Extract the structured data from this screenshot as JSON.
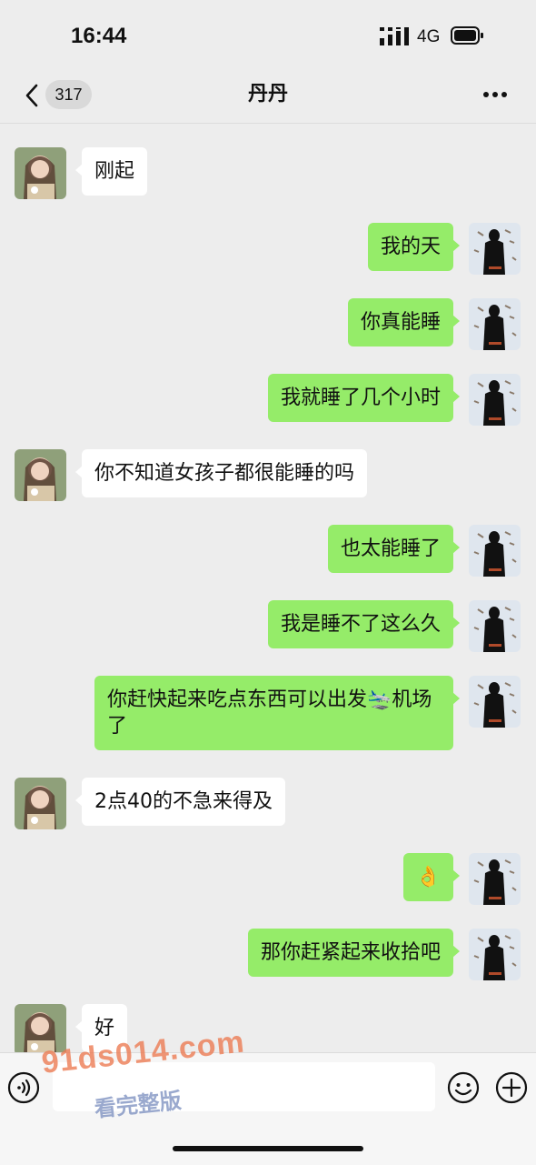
{
  "status": {
    "time": "16:44",
    "network": "4G"
  },
  "header": {
    "unread_count": "317",
    "title": "丹丹"
  },
  "messages": [
    {
      "side": "left",
      "text": "刚起"
    },
    {
      "side": "right",
      "text": "我的天"
    },
    {
      "side": "right",
      "text": "你真能睡"
    },
    {
      "side": "right",
      "text": "我就睡了几个小时"
    },
    {
      "side": "left",
      "text": "你不知道女孩子都很能睡的吗"
    },
    {
      "side": "right",
      "text": "也太能睡了"
    },
    {
      "side": "right",
      "text": "我是睡不了这么久"
    },
    {
      "side": "right",
      "text": "你赶快起来吃点东西可以出发🛬机场了"
    },
    {
      "side": "left",
      "text": "2点40的不急来得及"
    },
    {
      "side": "right",
      "text": "👌"
    },
    {
      "side": "right",
      "text": "那你赶紧起来收拾吧"
    },
    {
      "side": "left",
      "text": "好"
    }
  ],
  "input": {
    "placeholder": ""
  },
  "watermark": {
    "site": "91ds014.com",
    "caption": "看完整版"
  },
  "colors": {
    "background": "#ededed",
    "sent_bubble": "#95ec69",
    "received_bubble": "#ffffff",
    "input_bar": "#f6f6f6"
  },
  "icons": {
    "back": "chevron-left-icon",
    "more": "more-icon",
    "voice": "voice-icon",
    "emoji": "emoji-icon",
    "plus": "plus-icon"
  }
}
